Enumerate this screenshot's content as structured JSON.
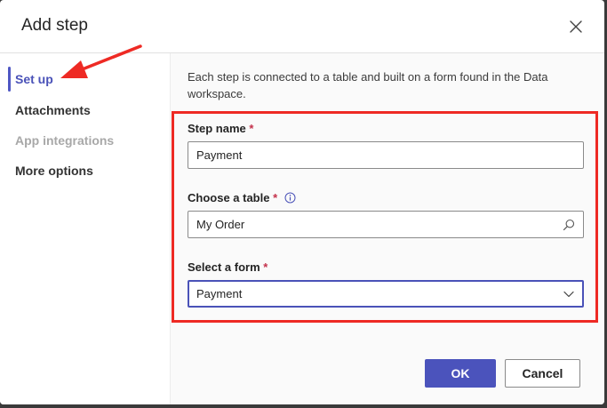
{
  "dialog": {
    "title": "Add step",
    "close_icon": "close-icon"
  },
  "sidebar": {
    "items": [
      {
        "label": "Set up",
        "state": "active"
      },
      {
        "label": "Attachments",
        "state": "normal"
      },
      {
        "label": "App integrations",
        "state": "disabled"
      },
      {
        "label": "More options",
        "state": "normal"
      }
    ]
  },
  "main": {
    "description": "Each step is connected to a table and built on a form found in the Data workspace.",
    "step_name": {
      "label": "Step name",
      "required": "*",
      "value": "Payment"
    },
    "table": {
      "label": "Choose a table",
      "required": "*",
      "info_icon": "info-icon",
      "value": "My Order",
      "search_icon": "search-icon"
    },
    "form": {
      "label": "Select a form",
      "required": "*",
      "value": "Payment",
      "chevron_icon": "chevron-down-icon"
    }
  },
  "footer": {
    "ok_label": "OK",
    "cancel_label": "Cancel"
  },
  "colors": {
    "accent": "#4b53bc",
    "annotation": "#ee2a24",
    "required": "#c4314b"
  }
}
